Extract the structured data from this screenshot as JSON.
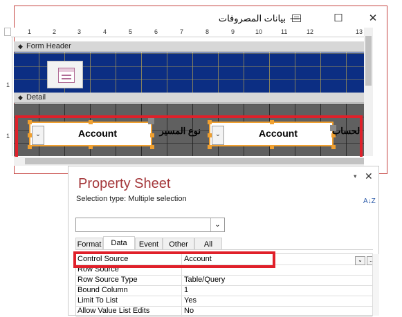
{
  "form_window": {
    "title": "بيانات المصروفات",
    "minimize_glyph": "—",
    "maximize_glyph": "☐",
    "close_glyph": "✕",
    "app_icon": "form-icon",
    "ruler_numbers": [
      "1",
      "2",
      "3",
      "4",
      "5",
      "6",
      "7",
      "8",
      "9",
      "10",
      "11",
      "12",
      "13"
    ],
    "v_ruler_numbers": [
      "1",
      "1"
    ],
    "sections": {
      "form_header": "Form Header",
      "detail": "Detail"
    },
    "controls": [
      {
        "value": "Account",
        "label": "نوع المسير"
      },
      {
        "value": "Account",
        "label": "الحساب"
      }
    ],
    "highlight_color": "#e0202a"
  },
  "property_sheet": {
    "title": "Property Sheet",
    "selection_type": "Selection type:  Multiple selection",
    "pin_glyph": "▾",
    "close_glyph": "✕",
    "sort_glyph": "A↓Z",
    "selected_object": "",
    "tabs": [
      "Format",
      "Data",
      "Event",
      "Other",
      "All"
    ],
    "active_tab": "Data",
    "properties": [
      {
        "name": "Control Source",
        "value": "Account"
      },
      {
        "name": "Row Source",
        "value": ""
      },
      {
        "name": "Row Source Type",
        "value": "Table/Query"
      },
      {
        "name": "Bound Column",
        "value": "1"
      },
      {
        "name": "Limit To List",
        "value": "Yes"
      },
      {
        "name": "Allow Value List Edits",
        "value": "No"
      }
    ],
    "builder_glyphs": [
      "⌄",
      "..."
    ],
    "title_color": "#a4373a"
  }
}
